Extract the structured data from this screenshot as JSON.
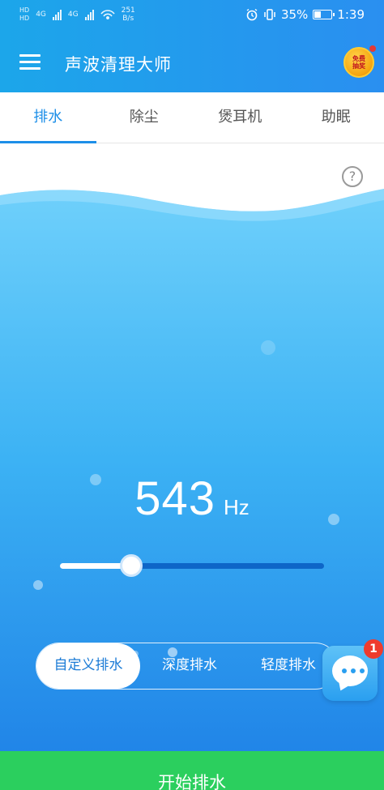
{
  "status_bar": {
    "sim1_label": "HD",
    "sim2_label": "HD",
    "net1": "4G",
    "net2": "4G",
    "speed_value": "251",
    "speed_unit": "B/s",
    "battery_percent": "35%",
    "time": "1:39"
  },
  "app_bar": {
    "title": "声波清理大师",
    "promo_badge": "免费抽奖"
  },
  "tabs": [
    {
      "label": "排水",
      "active": true
    },
    {
      "label": "除尘",
      "active": false
    },
    {
      "label": "煲耳机",
      "active": false
    },
    {
      "label": "助眠",
      "active": false
    }
  ],
  "help": {
    "symbol": "?"
  },
  "frequency": {
    "value": "543",
    "unit": "Hz",
    "slider_fraction": 0.27
  },
  "modes": [
    {
      "label": "自定义排水",
      "active": true
    },
    {
      "label": "深度排水",
      "active": false
    },
    {
      "label": "轻度排水",
      "active": false
    }
  ],
  "chat": {
    "badge_count": "1"
  },
  "start_button": {
    "label": "开始排水"
  },
  "colors": {
    "accent": "#1d8fe8",
    "water_top": "#6fd0fb",
    "water_bottom": "#1d7fe6",
    "start_green": "#2bcf5e",
    "badge_red": "#ef3b2d"
  }
}
